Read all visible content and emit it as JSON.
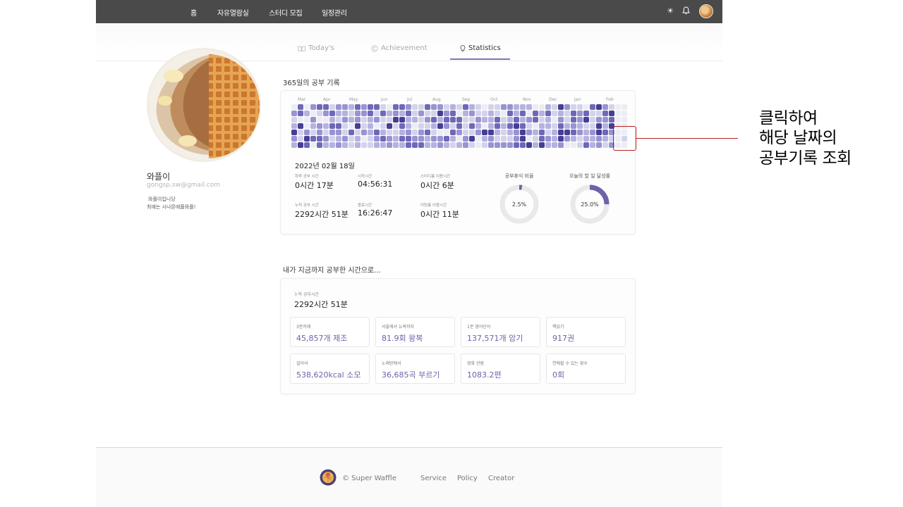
{
  "nav": {
    "items": [
      "홈",
      "자유열람실",
      "스터디 모집",
      "일정관리"
    ],
    "icons": [
      "sun-icon",
      "bell-icon",
      "avatar"
    ]
  },
  "tabs": [
    {
      "label": "Today's",
      "icon": "book-icon",
      "active": false
    },
    {
      "label": "Achievement",
      "icon": "copyright-icon",
      "active": false
    },
    {
      "label": "Statistics",
      "icon": "bulb-icon",
      "active": true
    }
  ],
  "profile": {
    "name": "와플이",
    "email": "gongsp.sw@gmail.com",
    "bio_line1": "와플이입니당",
    "bio_line2": "최애는 시나몬애플와플!"
  },
  "heatmap": {
    "title": "365일의 공부 기록",
    "months": [
      "Mar",
      "Apr",
      "May",
      "Jun",
      "Jul",
      "Aug",
      "Sep",
      "Oct",
      "Nov",
      "Dec",
      "Jan",
      "Feb"
    ],
    "palette": [
      "#ececf4",
      "#d4d3ec",
      "#b5b2e0",
      "#9893d2",
      "#6e68b8",
      "#453e94"
    ]
  },
  "day_stats": {
    "date": "2022년 02월 18일",
    "items": [
      {
        "label": "하루 공부 시간",
        "value": "0시간 17분"
      },
      {
        "label": "시작시간",
        "value": "04:56:31"
      },
      {
        "label": "스터디룸 이용시간",
        "value": "0시간 6분"
      },
      {
        "label": "누적 공부 시간",
        "value": "2292시간 51분"
      },
      {
        "label": "종료시간",
        "value": "16:26:47"
      },
      {
        "label": "미팅룸 이용시간",
        "value": "0시간 11분"
      }
    ],
    "donuts": [
      {
        "label": "공부휴식 비율",
        "value_text": "2.5%",
        "fraction": 0.025
      },
      {
        "label": "오늘의 할 일 달성률",
        "value_text": "25.0%",
        "fraction": 0.25
      }
    ],
    "accent": "#6b64a9"
  },
  "totals": {
    "title": "내가 지금까지 공부한 시간으로...",
    "cum_label": "누적 공부시간",
    "cum_value": "2292시간 51분",
    "cards": [
      {
        "label": "3분카레",
        "value": "45,857개 제조"
      },
      {
        "label": "서울에서 뉴욕까지",
        "value": "81.9회 왕복"
      },
      {
        "label": "1분 영어단어",
        "value": "137,571개 암기"
      },
      {
        "label": "책읽기",
        "value": "917권"
      },
      {
        "label": "걸어서",
        "value": "538,620kcal 소모"
      },
      {
        "label": "노래방에서",
        "value": "36,685곡 부르기"
      },
      {
        "label": "영화 관람",
        "value": "1083.2편"
      },
      {
        "label": "연애할 수 있는 횟수",
        "value": "0회"
      }
    ]
  },
  "footer": {
    "copyright": "© Super Waffle",
    "links": [
      "Service",
      "Policy",
      "Creator"
    ]
  },
  "annotation": {
    "line1": "클릭하여",
    "line2": "해당 날짜의",
    "line3": "공부기록 조회",
    "color": "#bb2222"
  }
}
